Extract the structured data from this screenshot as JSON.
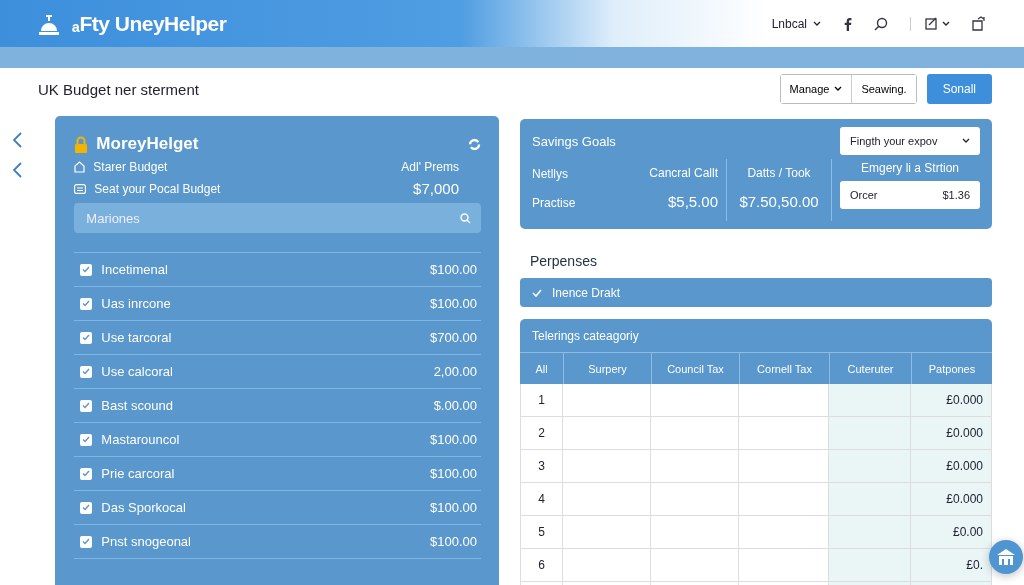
{
  "header": {
    "logo": "ₐFty UneyHelper",
    "language": "Lnbcal"
  },
  "page_title": "UK Budget ner sterment",
  "toolbar": {
    "segments": [
      "Manage",
      "Seawing."
    ],
    "primary": "Sonall"
  },
  "budget_panel": {
    "title": "MoreyHelget",
    "rows": [
      {
        "kind": "home",
        "label": "Starer Budget",
        "value": "Adl' Prems"
      },
      {
        "kind": "list",
        "label": "Seat your Pocal Budget",
        "value": "$7,000"
      }
    ],
    "search": {
      "placeholder": "Mariones"
    },
    "items": [
      {
        "label": "Incetimenal",
        "amount": "$100.00",
        "checked": true
      },
      {
        "label": "Uas inrcone",
        "amount": "$100.00",
        "checked": true
      },
      {
        "label": "Use tarcoral",
        "amount": "$700.00",
        "checked": true
      },
      {
        "label": "Use calcoral",
        "amount": "2,00.00",
        "checked": true
      },
      {
        "label": "Bast scound",
        "amount": "$.00.00",
        "checked": true
      },
      {
        "label": "Mastarouncol",
        "amount": "$100.00",
        "checked": true
      },
      {
        "label": "Prie carcoral",
        "amount": "$100.00",
        "checked": true
      },
      {
        "label": "Das Sporkocal",
        "amount": "$100.00",
        "checked": true
      },
      {
        "label": "Pnst snogeonal",
        "amount": "$100.00",
        "checked": true
      }
    ]
  },
  "savings": {
    "title": "Savings Goals",
    "col1": [
      "Netllys",
      "Practise"
    ],
    "col2": [
      "Cancral Callt",
      "$5,5.00"
    ],
    "col3": [
      "Datts / Took",
      "$7.50,50.00"
    ],
    "dropdown": "Fingth your expov",
    "caption": "Emgery li a Strtion",
    "box": {
      "label": "Orcer",
      "value": "$1.36"
    }
  },
  "expenses": {
    "title": "Perpenses",
    "bar": "Inence Drakt"
  },
  "table": {
    "title": "Telerings cateagoriy",
    "columns": [
      "All",
      "Surpery",
      "Council Tax",
      "Cornell Tax",
      "Cuteruter",
      "Patpones"
    ],
    "rows": [
      [
        "1",
        "£0.000"
      ],
      [
        "2",
        "£0.000"
      ],
      [
        "3",
        "£0.000"
      ],
      [
        "4",
        "£0.000"
      ],
      [
        "5",
        "£0.00"
      ],
      [
        "6",
        "£0."
      ]
    ]
  }
}
